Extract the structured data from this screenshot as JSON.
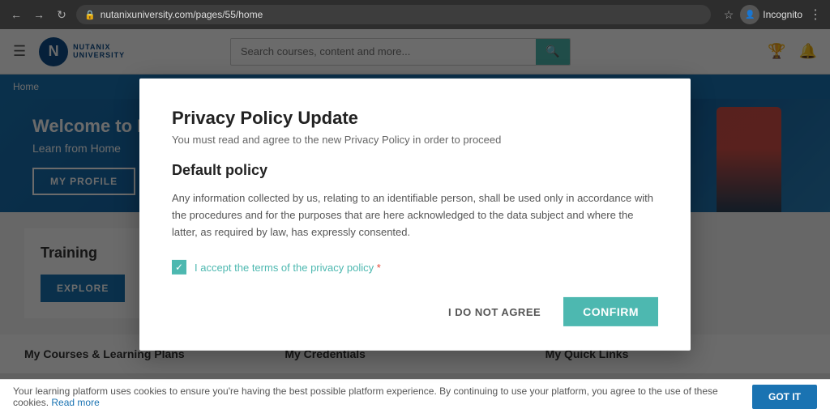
{
  "browser": {
    "url": "nutanixuniversity.com/pages/55/home",
    "incognito_label": "Incognito"
  },
  "nav": {
    "logo_letter": "N",
    "logo_name": "NUTANIX",
    "logo_sub": "UNIVERSITY",
    "search_placeholder": "Search courses, content and more...",
    "search_icon": "🔍"
  },
  "breadcrumb": {
    "home_label": "Home"
  },
  "hero": {
    "title": "Welcome to N",
    "subtitle": "Learn from Home",
    "profile_btn": "MY PROFILE"
  },
  "training": {
    "title": "Training",
    "explore_btn": "EXPLORE"
  },
  "bottom_sections": {
    "courses": "My Courses & Learning Plans",
    "credentials": "My Credentials",
    "quick_links": "My Quick Links"
  },
  "modal": {
    "title": "Privacy Policy Update",
    "subtitle": "You must read and agree to the new Privacy Policy in order to proceed",
    "policy_title": "Default policy",
    "policy_text": "Any information collected by us, relating to an identifiable person, shall be used only in accordance with the procedures and for the purposes that are here acknowledged to the data subject and where the latter, as required by law, has expressly consented.",
    "checkbox_label": "I accept the terms of the privacy policy",
    "required_marker": " *",
    "do_not_agree_btn": "I DO NOT AGREE",
    "confirm_btn": "CONFIRM"
  },
  "cookie": {
    "text": "Your learning platform uses cookies to ensure you're having the best possible platform experience. By continuing to use your platform, you agree to the use of these cookies.",
    "read_more": "Read more",
    "got_it_btn": "GOT IT"
  }
}
